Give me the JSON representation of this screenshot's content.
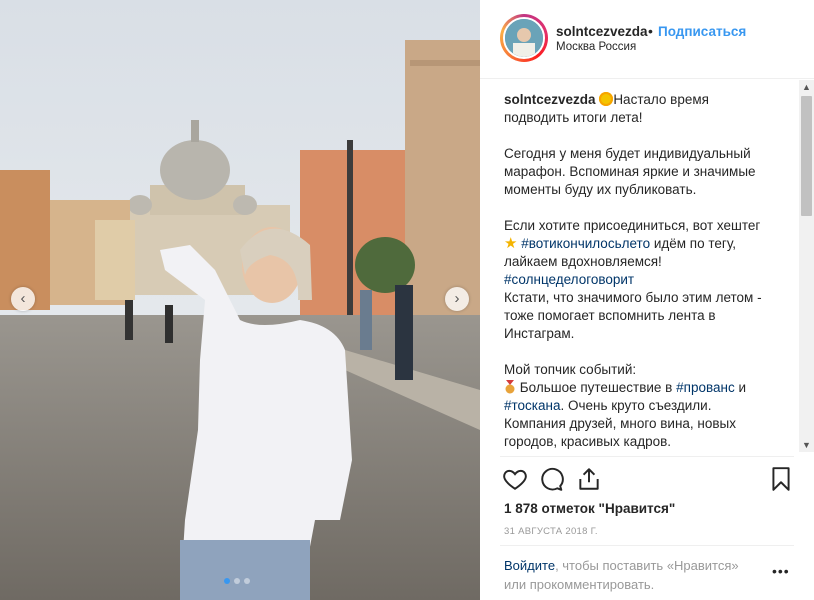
{
  "post": {
    "username": "solntcezvezda",
    "bullet": "•",
    "follow_label": "Подписаться",
    "location": "Москва Россия",
    "caption": {
      "author": "solntcezvezda",
      "line1": "Настало время подводить итоги лета!",
      "para2": "Сегодня у меня будет индивидуальный марафон. Вспоминая яркие и значимые моменты буду их публиковать.",
      "para3_a": "Если хотите присоединиться, вот хештег",
      "hashtag1": "#вотиконч­илосьлето",
      "para3_b": "идём по тегу, лайкаем вдохновляемся!",
      "hashtag2": "#солнцеделоговорит",
      "para3_c": "Кстати, что значимого было этим летом - тоже помогает вспомнить лента в Инстаграм.",
      "para4_a": "Мой топчик событий:",
      "para4_b": "Большое путешествие в",
      "hashtag3": "#прованс",
      "para4_c": "и",
      "hashtag4": "#тоскана",
      "para4_d": ". Очень круто съездили. Компания друзей, много вина, новых городов, красивых кадров."
    },
    "likes": "1 878 отметок \"Нравится\"",
    "date": "31 АВГУСТА 2018 Г.",
    "login_link": "Войдите",
    "login_text": ", чтобы поставить «Нравится» или прокомментировать.",
    "more": "•••",
    "carousel": {
      "prev": "‹",
      "next": "›",
      "slides": 3,
      "active_slide": 1
    }
  },
  "icons": [
    "heart-icon",
    "comment-icon",
    "share-icon",
    "bookmark-icon",
    "chevron-left-icon",
    "chevron-right-icon"
  ],
  "colors": {
    "link_blue": "#3897f0",
    "hashtag": "#003569",
    "text": "#262626",
    "muted": "#999999"
  }
}
